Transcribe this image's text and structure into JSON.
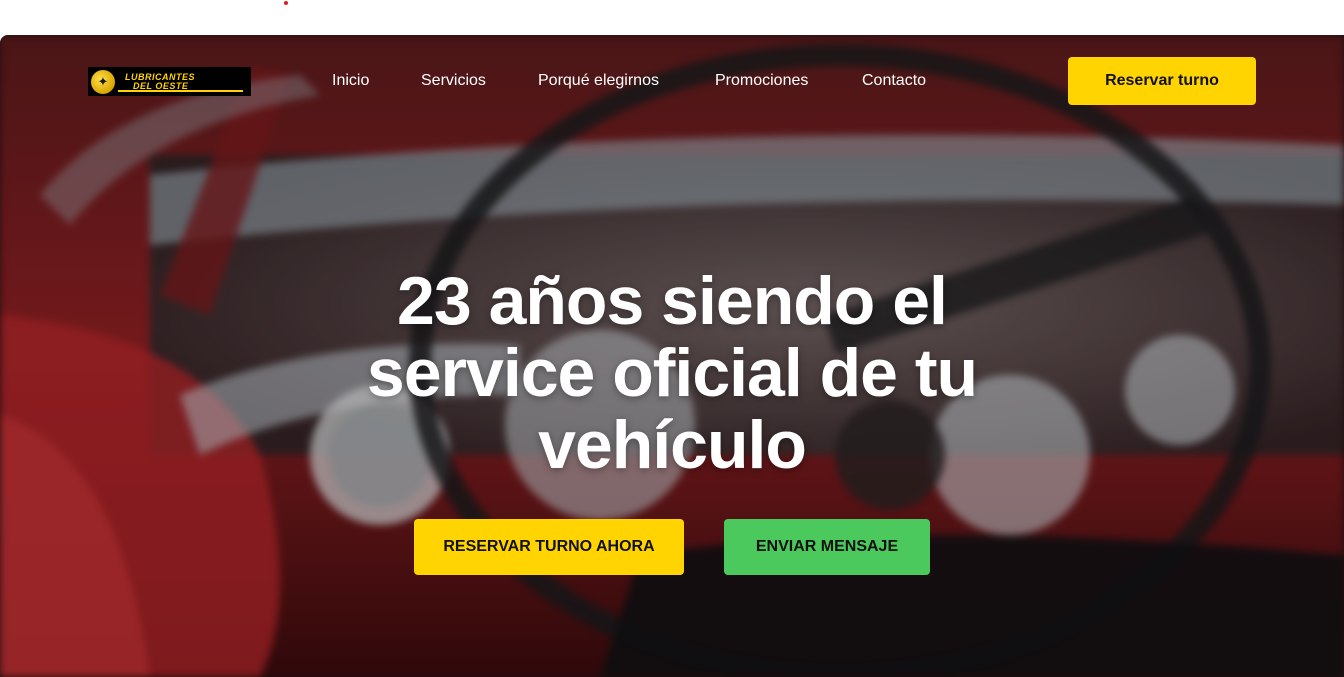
{
  "brand": {
    "logo_line1": "LUBRICANTES",
    "logo_line2": "DEL OESTE"
  },
  "nav": {
    "items": [
      "Inicio",
      "Servicios",
      "Porqué elegirnos",
      "Promociones",
      "Contacto"
    ],
    "cta_label": "Reservar turno"
  },
  "hero": {
    "headline_lines": [
      "23 años siendo el",
      "service oficial de tu",
      "vehículo"
    ],
    "primary_button": "RESERVAR TURNO AHORA",
    "secondary_button": "ENVIAR MENSAJE"
  },
  "colors": {
    "accent_yellow": "#ffd400",
    "accent_green": "#4cc95c",
    "text_light": "#ffffff"
  }
}
